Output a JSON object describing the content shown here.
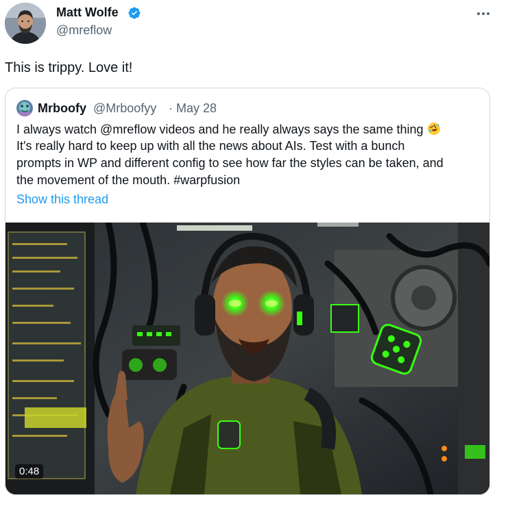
{
  "author": {
    "name": "Matt Wolfe",
    "handle": "@mreflow",
    "verified": true,
    "badge_color": "#1d9bf0"
  },
  "tweet": {
    "text": "This is trippy. Love it!"
  },
  "more_icon": "more-horizontal-icon",
  "quoted": {
    "name": "Mrboofy",
    "handle": "@Mrboofyy",
    "separator": "·",
    "date": "May 28",
    "lines": [
      {
        "before": "I always watch ",
        "mention": "@mreflow",
        "after": " videos and he really always says the same thing"
      },
      "It's really hard to keep up with all the news about AIs. Test with a bunch",
      "prompts in WP and different config to see how far the styles can be taken, and",
      "the movement of the mouth. #warpfusion"
    ],
    "emoji": "rolling-on-floor-laughing-icon",
    "show_thread": "Show this thread",
    "link_color": "#1d9bf0"
  },
  "media": {
    "type": "video",
    "duration": "0:48",
    "accent_color": "#39ff14"
  }
}
